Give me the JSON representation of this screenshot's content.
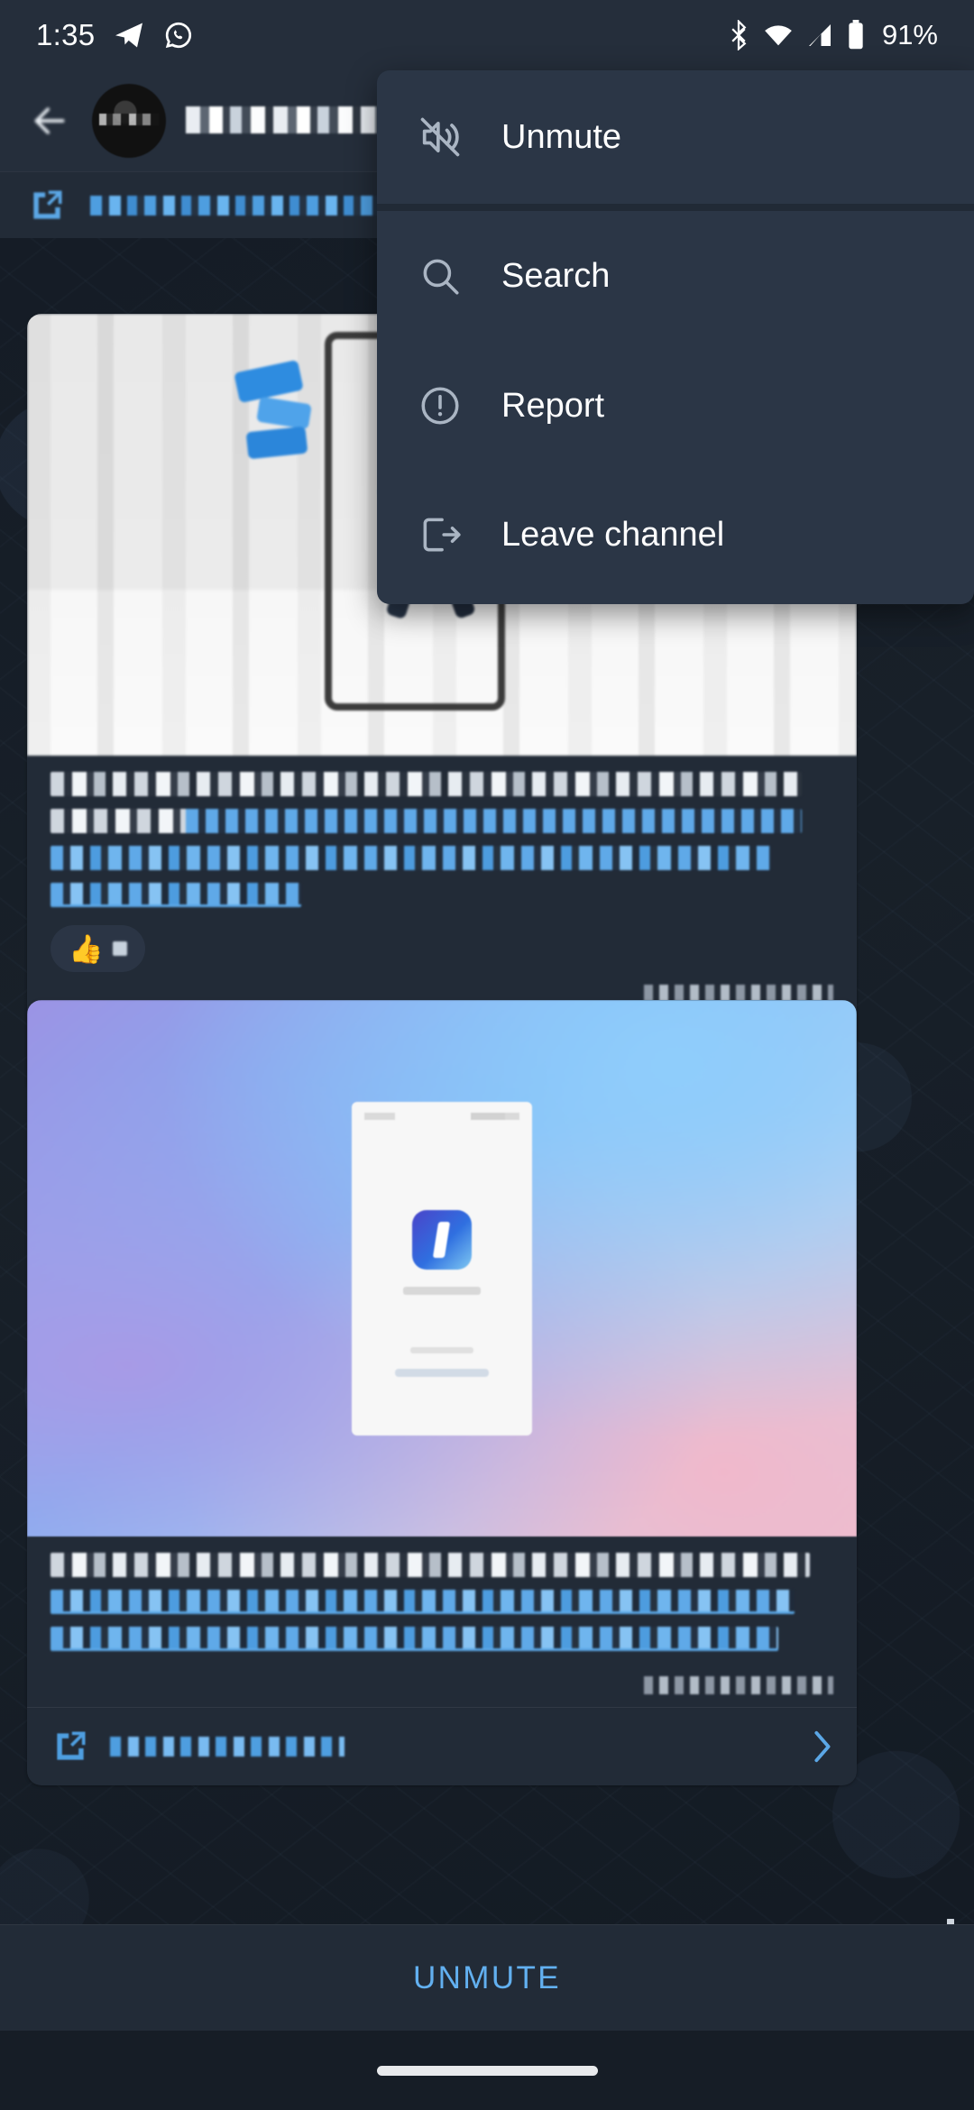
{
  "status_bar": {
    "time": "1:35",
    "left_icons": [
      "telegram-icon",
      "whatsapp-icon"
    ],
    "right_icons": [
      "bluetooth-icon",
      "wifi-icon",
      "cellular-signal-icon",
      "battery-icon"
    ],
    "battery_percent": "91%"
  },
  "header": {
    "back_icon": "back-arrow-icon",
    "avatar": "channel-avatar",
    "title_redacted": "",
    "subtitle_redacted": ""
  },
  "pinned": {
    "icon": "pinned-message-icon",
    "text_redacted": ""
  },
  "messages": [
    {
      "id": "message-1",
      "photo": "person-jumping-with-phone-frame-photo",
      "text_lines": [
        {
          "style": "white",
          "text_redacted": ""
        },
        {
          "style": "link",
          "text_redacted": ""
        },
        {
          "style": "link",
          "text_redacted": ""
        },
        {
          "style": "link-underline",
          "text_redacted": ""
        }
      ],
      "reaction": {
        "emoji": "👍",
        "count_redacted": ""
      },
      "meta_redacted": "",
      "footer": {
        "badge": "android-app-icon",
        "label_redacted": "",
        "chevron": "chevron-right-icon"
      }
    },
    {
      "id": "message-2",
      "photo": "gradient-app-mockup-photo",
      "text_lines": [
        {
          "style": "white",
          "text_redacted": ""
        },
        {
          "style": "link-underline",
          "text_redacted": ""
        },
        {
          "style": "link-underline",
          "text_redacted": ""
        }
      ],
      "meta_redacted": "",
      "footer": {
        "badge": "comments-icon",
        "label_redacted": "",
        "chevron": "chevron-right-icon"
      }
    }
  ],
  "context_menu": {
    "items": [
      {
        "label": "Unmute",
        "icon": "mute-off-icon"
      },
      {
        "label": "Search",
        "icon": "search-icon"
      },
      {
        "label": "Report",
        "icon": "report-exclamation-icon"
      },
      {
        "label": "Leave channel",
        "icon": "leave-exit-icon"
      }
    ]
  },
  "bottom_bar": {
    "unmute_label": "UNMUTE"
  },
  "colors": {
    "accent_blue": "#62b0f0",
    "panel": "#222b37",
    "menu_bg": "#2b3646",
    "chat_bg": "#151c26"
  }
}
